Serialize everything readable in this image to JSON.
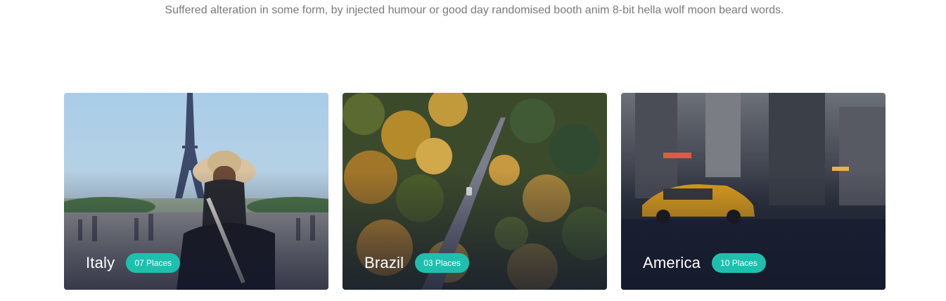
{
  "section": {
    "subtitle": "Suffered alteration in some form, by injected humour or good day randomised booth anim 8-bit hella wolf moon beard words."
  },
  "destinations": [
    {
      "name": "Italy",
      "places": "07 Places"
    },
    {
      "name": "Brazil",
      "places": "03 Places"
    },
    {
      "name": "America",
      "places": "10 Places"
    }
  ],
  "colors": {
    "badge": "#1fbfae",
    "subtitle_text": "#7a7a7a"
  }
}
